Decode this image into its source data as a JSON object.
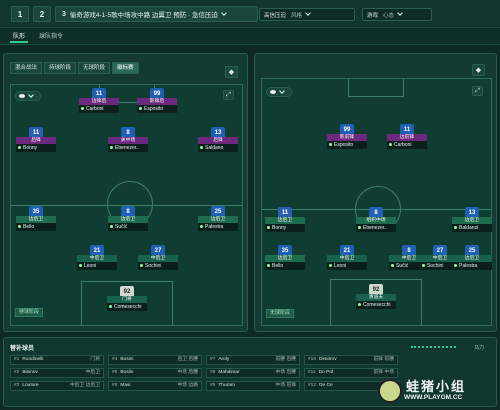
{
  "topbar": {
    "tab1": "1",
    "tab2": "2",
    "tactic_number": "3",
    "tactic_name": "偷奇游戏4-1-5歌中场攻中路 边翼卫 预防 · 急信压迫",
    "mentality_label": "高信压迫",
    "mentality_value": "风格",
    "mode_label": "游戏",
    "mode_value": "心态"
  },
  "subtabs": [
    "队形",
    "球队指令"
  ],
  "left_panel": {
    "tabs": [
      "混合战法",
      "持球阶段",
      "无球阶段",
      "徽标赛"
    ],
    "status": "持球阶段",
    "players": [
      {
        "num": "11",
        "role": "边锋后",
        "name": "Carboni",
        "role_style": "purple",
        "shirt": "blue"
      },
      {
        "num": "99",
        "role": "影锋后",
        "name": "Esposito",
        "role_style": "purple",
        "shirt": "blue"
      },
      {
        "num": "11",
        "role": "后锋",
        "name": "Bonny",
        "role_style": "purple",
        "shirt": "red"
      },
      {
        "num": "8",
        "role": "关中场",
        "name": "Ebenezer..",
        "role_style": "purple",
        "shirt": "blue"
      },
      {
        "num": "13",
        "role": "后锋",
        "name": "Saldano",
        "role_style": "purple",
        "shirt": "blue"
      },
      {
        "num": "35",
        "role": "边后卫",
        "name": "Bello",
        "role_style": "green",
        "shirt": "blue"
      },
      {
        "num": "8",
        "role": "边后卫",
        "name": "Sučić",
        "role_style": "green",
        "shirt": "blue"
      },
      {
        "num": "25",
        "role": "边后卫",
        "name": "Palestra",
        "role_style": "green",
        "shirt": "blue"
      },
      {
        "num": "21",
        "role": "中后卫",
        "name": "Leoni",
        "role_style": "teal",
        "shirt": "blue"
      },
      {
        "num": "27",
        "role": "中后卫",
        "name": "Sochini",
        "role_style": "teal",
        "shirt": "blue"
      },
      {
        "num": "92",
        "role": "门将",
        "name": "Comesecchi",
        "role_style": "teal",
        "shirt": "gk"
      }
    ]
  },
  "right_panel": {
    "status": "无球阶段",
    "players": [
      {
        "num": "99",
        "role": "影前锋",
        "name": "Esposito",
        "role_style": "purple",
        "shirt": "blue"
      },
      {
        "num": "11",
        "role": "边前锋",
        "name": "Carboni",
        "role_style": "purple",
        "shirt": "blue"
      },
      {
        "num": "11",
        "role": "边后卫",
        "name": "Bonny",
        "role_style": "green",
        "shirt": "red"
      },
      {
        "num": "8",
        "role": "组织中场",
        "name": "Ebenezer..",
        "role_style": "green",
        "shirt": "blue"
      },
      {
        "num": "13",
        "role": "边后卫",
        "name": "Baldanzi",
        "role_style": "green",
        "shirt": "blue"
      },
      {
        "num": "35",
        "role": "边后卫",
        "name": "Bello",
        "role_style": "green",
        "shirt": "blue"
      },
      {
        "num": "21",
        "role": "中后卫",
        "name": "Leoni",
        "role_style": "teal",
        "shirt": "blue"
      },
      {
        "num": "8",
        "role": "中后卫",
        "name": "Sučić",
        "role_style": "teal",
        "shirt": "blue"
      },
      {
        "num": "27",
        "role": "中后卫",
        "name": "Sochini",
        "role_style": "teal",
        "shirt": "blue"
      },
      {
        "num": "25",
        "role": "边后卫",
        "name": "Palestra",
        "role_style": "teal",
        "shirt": "blue"
      },
      {
        "num": "92",
        "role": "清道夫",
        "name": "Comesecchi",
        "role_style": "teal",
        "shirt": "gk"
      }
    ]
  },
  "substitutes": {
    "title": "替补球员",
    "rest_label": "马力",
    "items": [
      {
        "num": "#1",
        "name": "Rondinelli",
        "pos": "门将"
      },
      {
        "num": "#2",
        "name": "Bisinov",
        "pos": "中后卫"
      },
      {
        "num": "#3",
        "name": "Loutore",
        "pos": "中后卫 边后卫"
      },
      {
        "num": "#4",
        "name": "Bosini",
        "pos": "后卫 后腰"
      },
      {
        "num": "#5",
        "name": "Bosilo",
        "pos": "中场 后腰"
      },
      {
        "num": "#6",
        "name": "Masi",
        "pos": "中场 边路"
      },
      {
        "num": "#7",
        "name": "Aroly",
        "pos": "前腰 后腰"
      },
      {
        "num": "#8",
        "name": "Mahdimar",
        "pos": "中场 后腰"
      },
      {
        "num": "#9",
        "name": "Thuram",
        "pos": "中场 前锋"
      },
      {
        "num": "#10",
        "name": "Dimitrov",
        "pos": "前锋 前腰"
      },
      {
        "num": "#11",
        "name": "Do Pol",
        "pos": "前锋 中场"
      },
      {
        "num": "#12",
        "name": "De Ce",
        "pos": "中锋"
      }
    ]
  },
  "watermark": {
    "text": "蛙猪小组",
    "url": "WWW.PLAYGM.CC"
  }
}
